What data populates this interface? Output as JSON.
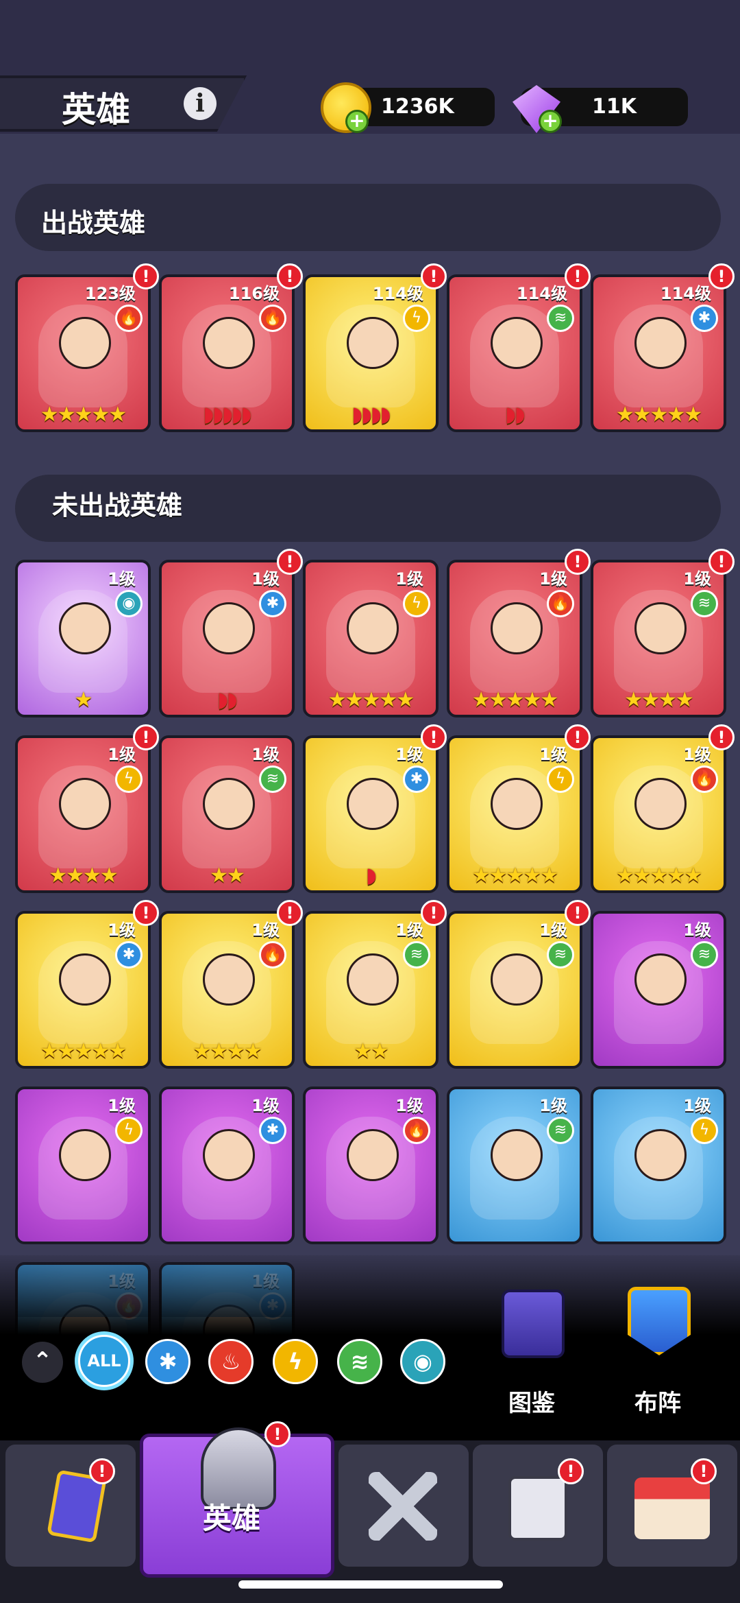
{
  "header": {
    "title": "英雄",
    "gold": "1236K",
    "gems": "11K"
  },
  "sections": {
    "active": "出战英雄",
    "inactive": "未出战英雄"
  },
  "active_heroes": [
    {
      "level": "123级",
      "element": "fire",
      "stars": "★★★★★",
      "rank": "star",
      "color": "red",
      "alert": true
    },
    {
      "level": "116级",
      "element": "fire",
      "stars": "◗◗◗◗◗",
      "rank": "moon",
      "color": "red",
      "alert": true
    },
    {
      "level": "114级",
      "element": "bolt",
      "stars": "◗◗◗◗",
      "rank": "moon",
      "color": "yellow",
      "alert": true
    },
    {
      "level": "114级",
      "element": "wind",
      "stars": "◗◗",
      "rank": "moon",
      "color": "red",
      "alert": true
    },
    {
      "level": "114级",
      "element": "star",
      "stars": "★★★★★",
      "rank": "star",
      "color": "red",
      "alert": true
    }
  ],
  "inactive_heroes": [
    {
      "level": "1级",
      "element": "eye",
      "stars": "★",
      "rank": "star",
      "color": "pinkpurple",
      "alert": false
    },
    {
      "level": "1级",
      "element": "star",
      "stars": "◗◗",
      "rank": "moon",
      "color": "red",
      "alert": true
    },
    {
      "level": "1级",
      "element": "bolt",
      "stars": "★★★★★",
      "rank": "star",
      "color": "red",
      "alert": false
    },
    {
      "level": "1级",
      "element": "fire",
      "stars": "★★★★★",
      "rank": "star",
      "color": "red",
      "alert": true
    },
    {
      "level": "1级",
      "element": "wind",
      "stars": "★★★★",
      "rank": "star",
      "color": "red",
      "alert": true
    },
    {
      "level": "1级",
      "element": "bolt",
      "stars": "★★★★",
      "rank": "star",
      "color": "red",
      "alert": true
    },
    {
      "level": "1级",
      "element": "wind",
      "stars": "★★",
      "rank": "star",
      "color": "red",
      "alert": false
    },
    {
      "level": "1级",
      "element": "star",
      "stars": "◗",
      "rank": "moon",
      "color": "yellow",
      "alert": true
    },
    {
      "level": "1级",
      "element": "bolt",
      "stars": "★★★★★",
      "rank": "star",
      "color": "yellow",
      "alert": true
    },
    {
      "level": "1级",
      "element": "fire",
      "stars": "★★★★★",
      "rank": "star",
      "color": "yellow",
      "alert": true
    },
    {
      "level": "1级",
      "element": "star",
      "stars": "★★★★★",
      "rank": "star",
      "color": "yellow",
      "alert": true
    },
    {
      "level": "1级",
      "element": "fire",
      "stars": "★★★★",
      "rank": "star",
      "color": "yellow",
      "alert": true
    },
    {
      "level": "1级",
      "element": "wind",
      "stars": "★★",
      "rank": "star",
      "color": "yellow",
      "alert": true
    },
    {
      "level": "1级",
      "element": "wind",
      "stars": "",
      "rank": "star",
      "color": "yellow",
      "alert": true
    },
    {
      "level": "1级",
      "element": "wind",
      "stars": "",
      "rank": "star",
      "color": "purple",
      "alert": false
    },
    {
      "level": "1级",
      "element": "bolt",
      "stars": "",
      "rank": "star",
      "color": "purple",
      "alert": false
    },
    {
      "level": "1级",
      "element": "star",
      "stars": "",
      "rank": "star",
      "color": "purple",
      "alert": false
    },
    {
      "level": "1级",
      "element": "fire",
      "stars": "",
      "rank": "star",
      "color": "purple",
      "alert": false
    },
    {
      "level": "1级",
      "element": "wind",
      "stars": "",
      "rank": "star",
      "color": "blue",
      "alert": false
    },
    {
      "level": "1级",
      "element": "bolt",
      "stars": "",
      "rank": "star",
      "color": "blue",
      "alert": false
    },
    {
      "level": "1级",
      "element": "fire",
      "stars": "",
      "rank": "star",
      "color": "blue",
      "alert": false
    },
    {
      "level": "1级",
      "element": "star",
      "stars": "",
      "rank": "star",
      "color": "blue",
      "alert": false
    }
  ],
  "filters": {
    "all": "ALL",
    "icons": [
      "snowflake-icon",
      "fire-icon",
      "bolt-icon",
      "tornado-icon",
      "eye-icon"
    ]
  },
  "side_buttons": {
    "codex": "图鉴",
    "formation": "布阵"
  },
  "nav": {
    "heroes_label": "英雄"
  },
  "element_glyphs": {
    "fire": "🔥",
    "bolt": "ϟ",
    "wind": "≋",
    "star": "✱",
    "eye": "◉"
  },
  "colors": {
    "red": "#e5202c",
    "accent": "#a454ea",
    "gold": "#f2b400"
  }
}
